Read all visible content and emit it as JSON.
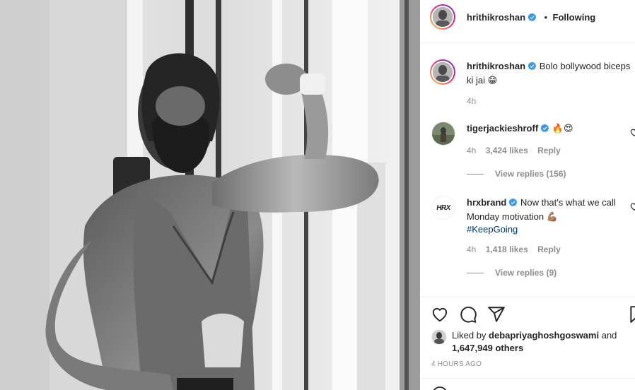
{
  "header": {
    "username": "hrithikroshan",
    "separator": "•",
    "follow_status": "Following"
  },
  "caption": {
    "username": "hrithikroshan",
    "text": "Bolo bollywood biceps ki jai 😁",
    "time": "4h"
  },
  "comments": [
    {
      "username": "tigerjackieshroff",
      "text": "🔥😍",
      "time": "4h",
      "likes": "3,424 likes",
      "reply_label": "Reply",
      "view_replies": "View replies (156)"
    },
    {
      "username": "hrxbrand",
      "text": "Now that's what we call Monday motivation 💪🏽",
      "hashtag": "#KeepGoing",
      "time": "4h",
      "likes": "1,418 likes",
      "reply_label": "Reply",
      "view_replies": "View replies (9)",
      "avatar_logo": "HRX"
    }
  ],
  "likes_summary": {
    "prefix": "Liked by",
    "user": "debapriyaghoshgoswami",
    "conjunction": "and",
    "others": "1,647,949 others"
  },
  "post_time": "4 HOURS AGO",
  "icons": {
    "like": "heart-icon",
    "comment": "comment-icon",
    "share": "share-icon",
    "save": "bookmark-icon",
    "verified": "verified-badge-icon"
  },
  "colors": {
    "verified": "#3897f0",
    "link": "#00376b",
    "muted": "#8e8e8e",
    "text": "#262626"
  }
}
